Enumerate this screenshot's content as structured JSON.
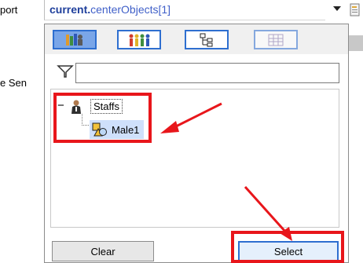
{
  "left_panel": {
    "label_1": "port",
    "label_2": "e Sen"
  },
  "expression": {
    "bold_part": "current.",
    "rest_part": "centerObjects[1]"
  },
  "popup": {
    "toolbar": [
      {
        "icon": "people-objects-icon",
        "selected": true
      },
      {
        "icon": "colored-people-icon",
        "selected": false
      },
      {
        "icon": "hierarchy-tree-icon",
        "selected": false
      },
      {
        "icon": "grid-table-icon",
        "selected": false
      }
    ],
    "filter": {
      "icon": "funnel-icon",
      "value": ""
    },
    "tree": {
      "expander": "−",
      "root_label": "Staffs",
      "child_label": "Male1"
    },
    "buttons": {
      "clear": "Clear",
      "select": "Select"
    }
  },
  "colors": {
    "annotation_red": "#e8161b",
    "accent_blue": "#2e6fd0",
    "selection_bg": "#cfe0fb"
  }
}
